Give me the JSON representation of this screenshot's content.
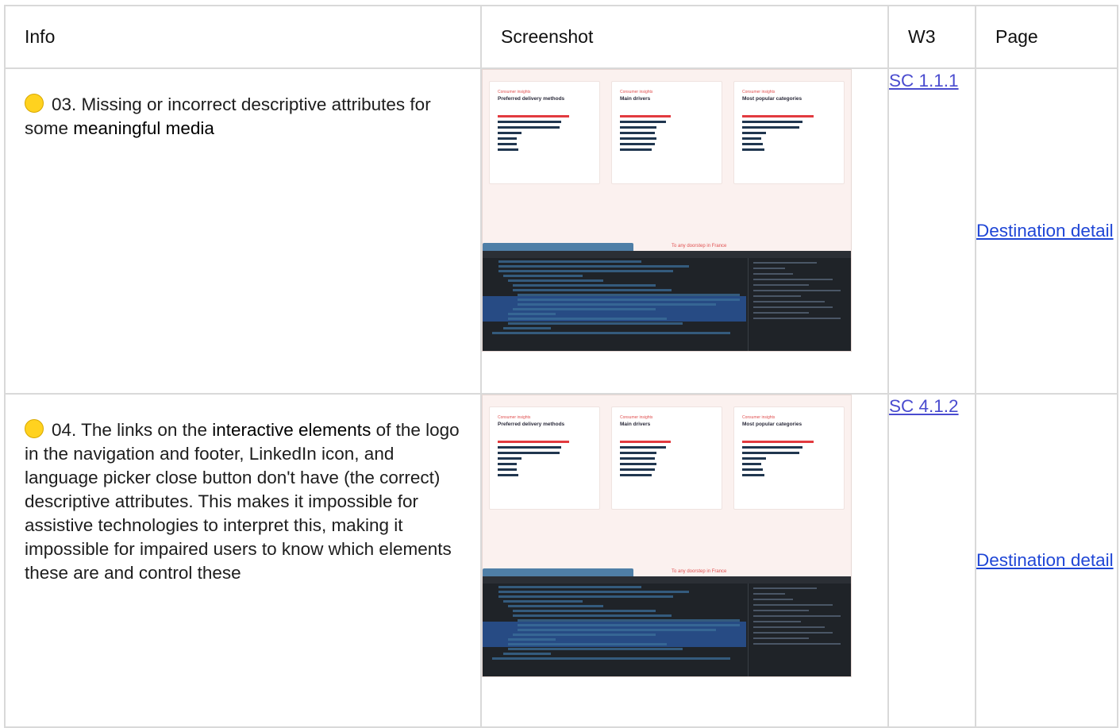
{
  "table": {
    "headers": [
      "Info",
      "Screenshot",
      "W3",
      "Page"
    ]
  },
  "rows": [
    {
      "number_text": "03. Missing or incorrect descriptive attributes for some ",
      "emphasis": "meaningful media",
      "after_emphasis": "",
      "severity_color": "#ffd21f",
      "w3_link": "SC 1.1.1",
      "page_link": "Destination detail",
      "screenshot": {
        "cards": [
          {
            "eyebrow": "Consumer insights",
            "title": "Preferred delivery methods"
          },
          {
            "eyebrow": "Consumer insights",
            "title": "Main drivers"
          },
          {
            "eyebrow": "Consumer insights",
            "title": "Most popular categories"
          }
        ],
        "strip_text": "To any doorstep in France"
      }
    },
    {
      "number_text": "04. The links on the ",
      "emphasis": "interactive elements",
      "after_emphasis": " of the logo in the navigation and footer, LinkedIn icon, and language picker close button don't have (the correct) descriptive attributes. This makes it impossible for assistive technologies to interpret this, making it impossible for impaired users to know which elements these are and control these",
      "severity_color": "#ffd21f",
      "w3_link": "SC 4.1.2",
      "page_link": "Destination detail",
      "screenshot": {
        "cards": [
          {
            "eyebrow": "Consumer insights",
            "title": "Preferred delivery methods"
          },
          {
            "eyebrow": "Consumer insights",
            "title": "Main drivers"
          },
          {
            "eyebrow": "Consumer insights",
            "title": "Most popular categories"
          }
        ],
        "strip_text": "To any doorstep in France"
      }
    }
  ]
}
